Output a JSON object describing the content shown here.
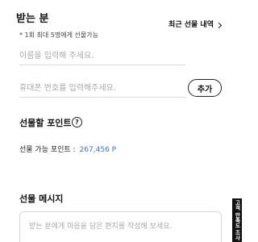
{
  "recipient": {
    "title": "받는 분",
    "recent_gift_link": "최근 선물 내역",
    "note": "* 1회 최대 5명에게 선물가능",
    "name_placeholder": "이름을 입력해 주세요.",
    "phone_placeholder": "휴대폰 번호를 입력해주세요.",
    "add_button": "추가"
  },
  "points": {
    "title": "선물할 포인트",
    "help_symbol": "?",
    "available_label": "선물 가능 포인트 :",
    "available_value": "267,456 P"
  },
  "message": {
    "title": "선물 메시지",
    "placeholder": "받는 분에게 마음을 담은 편지를 작성해 보세요."
  },
  "side_tab": {
    "label": "고객 만족도 조사"
  },
  "colors": {
    "accent_blue": "#3a73c9",
    "text_dark": "#111111",
    "border_light": "#d9d9d9"
  },
  "icons": {
    "recent_link_chevron": "chevron-right-icon",
    "help": "question-circle-icon"
  }
}
